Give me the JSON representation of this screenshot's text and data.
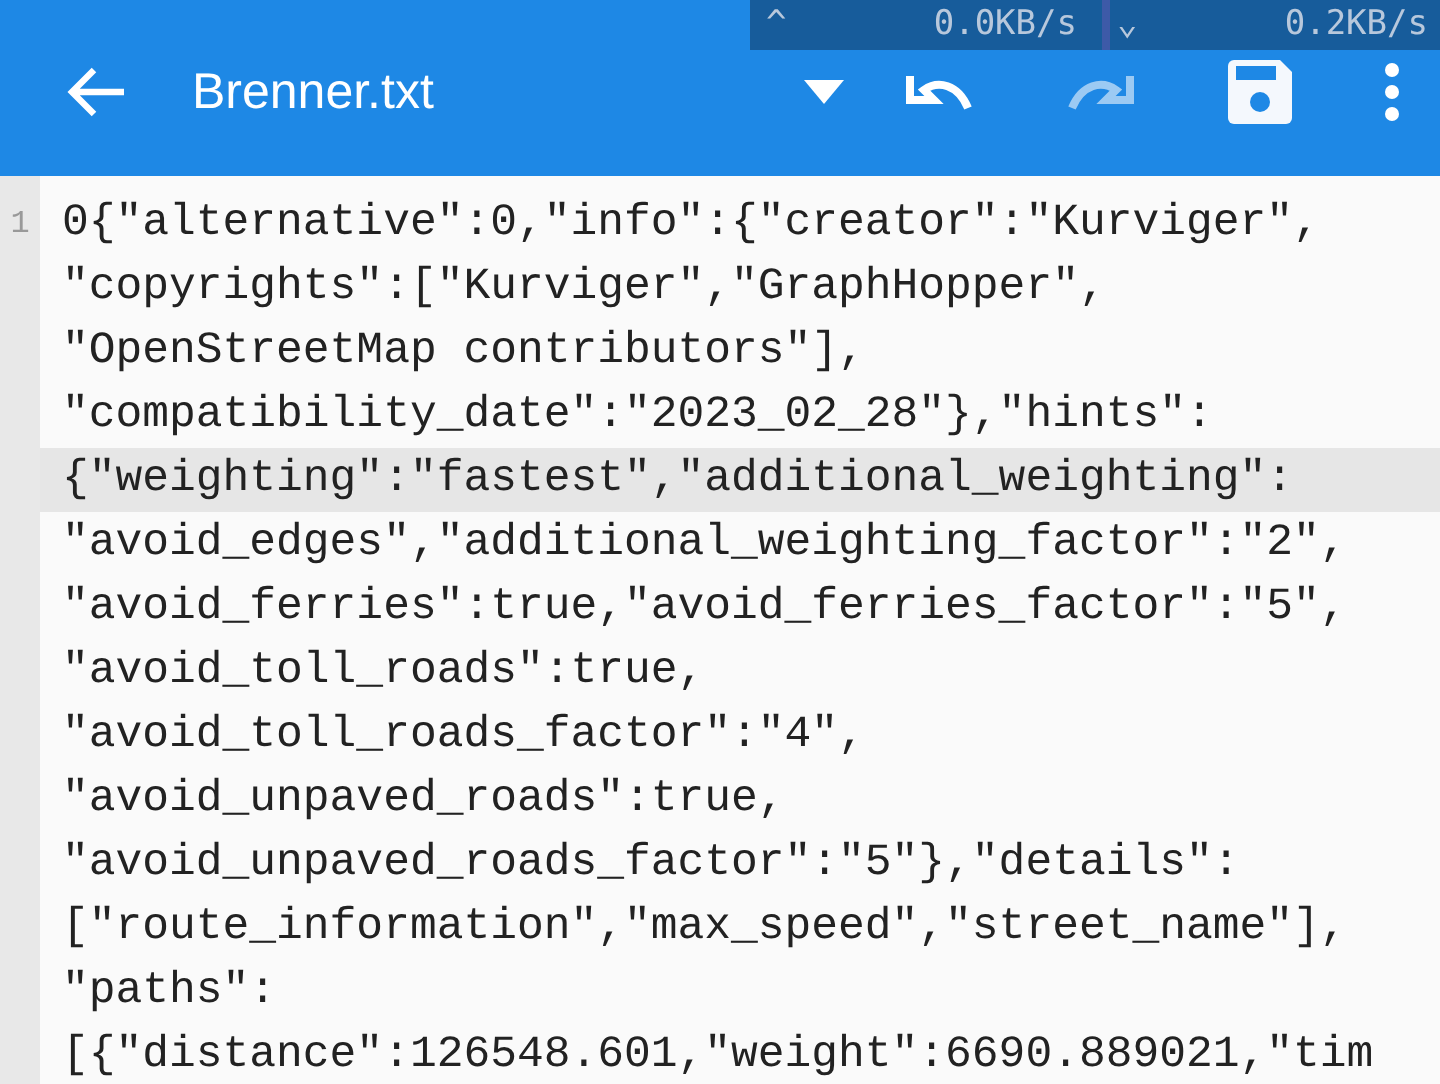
{
  "network_overlay": {
    "upload": {
      "arrow": "^",
      "rate": "0.0KB/s"
    },
    "download": {
      "arrow": "⌄",
      "rate": "0.2KB/s"
    }
  },
  "app_bar": {
    "title": "Brenner.txt",
    "undo_enabled": true,
    "redo_enabled": false
  },
  "editor": {
    "line_number": "1",
    "lines": [
      {
        "text": "0{\"alternative\":0,\"info\":{\"creator\":\"Kurviger\",",
        "highlighted": false
      },
      {
        "text": "\"copyrights\":[\"Kurviger\",\"GraphHopper\",",
        "highlighted": false
      },
      {
        "text": "\"OpenStreetMap contributors\"],",
        "highlighted": false
      },
      {
        "text": "\"compatibility_date\":\"2023_02_28\"},\"hints\":",
        "highlighted": false
      },
      {
        "text": "{\"weighting\":\"fastest\",\"additional_weighting\":",
        "highlighted": true
      },
      {
        "text": "\"avoid_edges\",\"additional_weighting_factor\":\"2\",",
        "highlighted": false
      },
      {
        "text": "\"avoid_ferries\":true,\"avoid_ferries_factor\":\"5\",",
        "highlighted": false
      },
      {
        "text": "\"avoid_toll_roads\":true,",
        "highlighted": false
      },
      {
        "text": "\"avoid_toll_roads_factor\":\"4\",",
        "highlighted": false
      },
      {
        "text": "\"avoid_unpaved_roads\":true,",
        "highlighted": false
      },
      {
        "text": "\"avoid_unpaved_roads_factor\":\"5\"},\"details\":",
        "highlighted": false
      },
      {
        "text": "[\"route_information\",\"max_speed\",\"street_name\"],",
        "highlighted": false
      },
      {
        "text": "\"paths\":",
        "highlighted": false
      },
      {
        "text": "[{\"distance\":126548.601,\"weight\":6690.889021,\"tim",
        "highlighted": false
      }
    ]
  }
}
